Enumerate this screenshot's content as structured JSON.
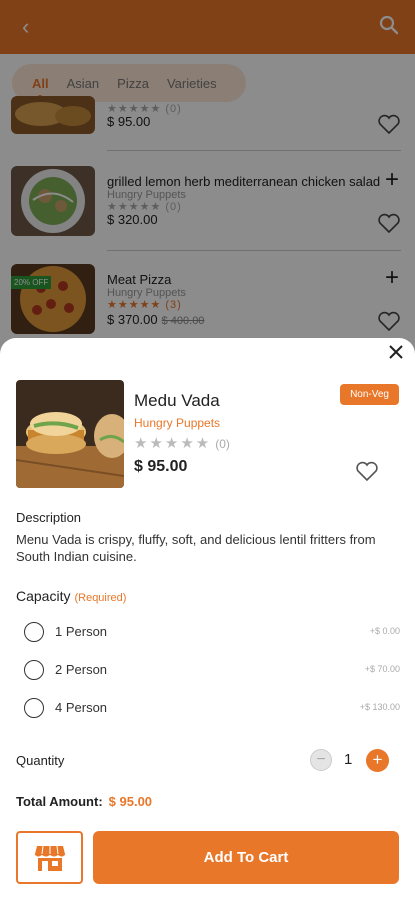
{
  "header": {
    "back_icon": "chevron-left-icon",
    "search_icon": "search-icon"
  },
  "tabs": [
    {
      "label": "All",
      "active": true
    },
    {
      "label": "Asian",
      "active": false
    },
    {
      "label": "Pizza",
      "active": false
    },
    {
      "label": "Varieties",
      "active": false
    }
  ],
  "list": [
    {
      "title": "",
      "sub": "",
      "stars": "★★★★★ (0)",
      "price": "$ 95.00",
      "strike": ""
    },
    {
      "title": "grilled lemon herb mediterranean chicken salad",
      "sub": "Hungry Puppets",
      "stars": "★★★★★ (0)",
      "price": "$ 320.00",
      "strike": ""
    },
    {
      "title": "Meat Pizza",
      "sub": "Hungry Puppets",
      "stars": "★★★★★ (3)",
      "price": "$ 370.00",
      "strike": "$ 400.00",
      "badge": "20% OFF"
    }
  ],
  "product": {
    "name": "Medu Vada",
    "restaurant": "Hungry Puppets",
    "stars": "★★★★★",
    "rating_count": "(0)",
    "price": "$ 95.00",
    "badge": "Non-Veg"
  },
  "description": {
    "title": "Description",
    "text": "Menu Vada is crispy, fluffy, soft, and delicious lentil fritters from South Indian cuisine."
  },
  "capacity": {
    "title": "Capacity",
    "required": "(Required)",
    "options": [
      {
        "label": "1 Person",
        "price": "+$ 0.00"
      },
      {
        "label": "2 Person",
        "price": "+$ 70.00"
      },
      {
        "label": "4 Person",
        "price": "+$ 130.00"
      }
    ]
  },
  "quantity": {
    "label": "Quantity",
    "value": "1",
    "minus": "−",
    "plus": "+"
  },
  "total": {
    "label": "Total Amount:",
    "value": "$ 95.00"
  },
  "actions": {
    "add_to_cart": "Add To Cart",
    "store_icon": "store-icon"
  },
  "colors": {
    "accent": "#e9772a",
    "badge_green": "#2e9b3a"
  }
}
